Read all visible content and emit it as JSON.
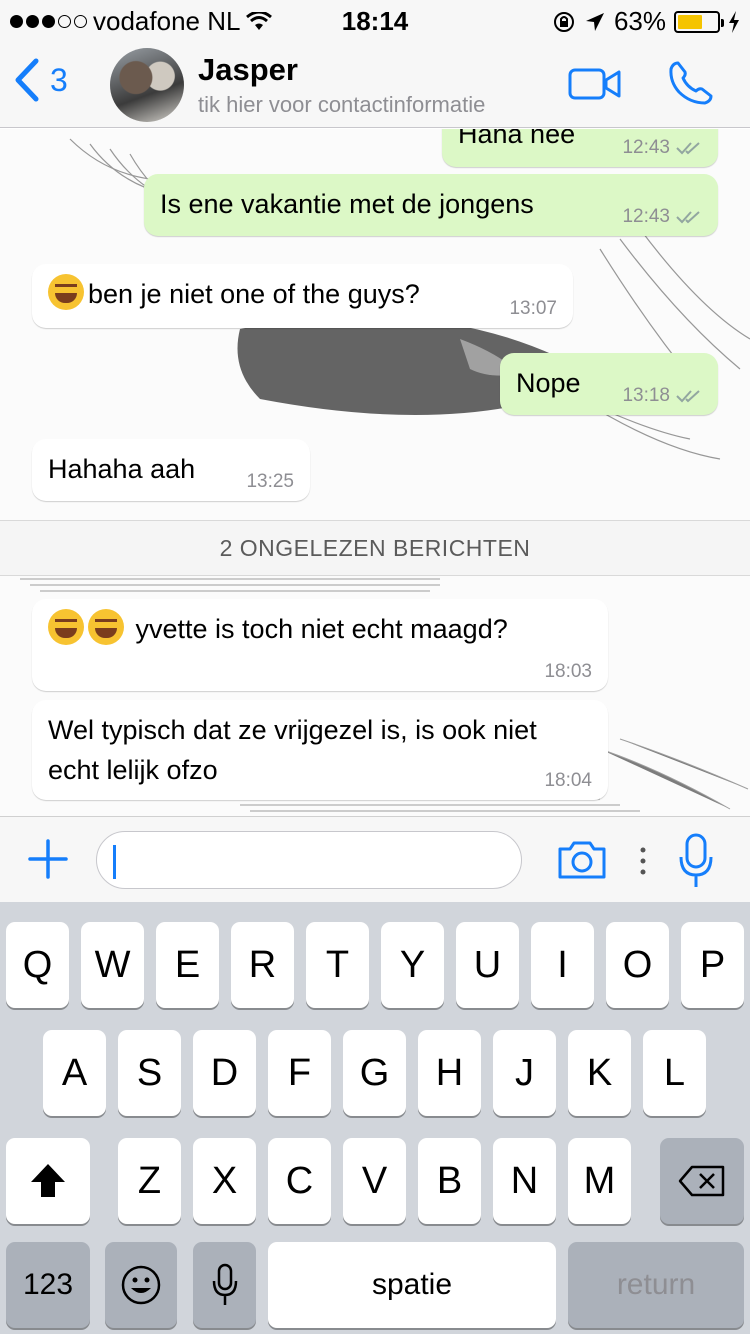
{
  "status_bar": {
    "carrier": "vodafone NL",
    "time": "18:14",
    "battery_percent": "63%",
    "battery_level": 0.63,
    "signal_bars": 3
  },
  "nav": {
    "back_count": "3",
    "contact_name": "Jasper",
    "contact_subtitle": "tik hier voor contactinformatie"
  },
  "messages": [
    {
      "direction": "out",
      "text": "Haha nee",
      "time": "12:43"
    },
    {
      "direction": "out",
      "text": "Is ene vakantie met de jongens",
      "time": "12:43"
    },
    {
      "direction": "in",
      "text": "ben je niet one of the guys?",
      "time": "13:07"
    },
    {
      "direction": "out",
      "text": "Nope",
      "time": "13:18"
    },
    {
      "direction": "in",
      "text": "Hahaha aah",
      "time": "13:25"
    },
    {
      "direction": "in",
      "text": "yvette is toch niet echt maagd?",
      "time": "18:03"
    },
    {
      "direction": "in",
      "text": "Wel typisch dat ze vrijgezel is, is ook niet echt lelijk ofzo",
      "time": "18:04"
    }
  ],
  "unread_banner": "2 ONGELEZEN BERICHTEN",
  "input": {
    "value": "",
    "placeholder": ""
  },
  "keyboard": {
    "row1": [
      "Q",
      "W",
      "E",
      "R",
      "T",
      "Y",
      "U",
      "I",
      "O",
      "P"
    ],
    "row2": [
      "A",
      "S",
      "D",
      "F",
      "G",
      "H",
      "J",
      "K",
      "L"
    ],
    "row3": [
      "Z",
      "X",
      "C",
      "V",
      "B",
      "N",
      "M"
    ],
    "numbers_key": "123",
    "space_key": "spatie",
    "return_key": "return"
  },
  "colors": {
    "accent": "#157efb",
    "outgoing_bubble": "#dcf8c6",
    "incoming_bubble": "#ffffff",
    "battery": "#f5c400"
  },
  "icons": [
    "back-chevron-icon",
    "video-call-icon",
    "phone-icon",
    "plus-icon",
    "camera-icon",
    "more-dots-icon",
    "microphone-icon",
    "shift-icon",
    "backspace-icon",
    "emoji-icon",
    "double-check-icon",
    "location-icon",
    "lock-rotation-icon",
    "wifi-icon",
    "charging-icon"
  ]
}
